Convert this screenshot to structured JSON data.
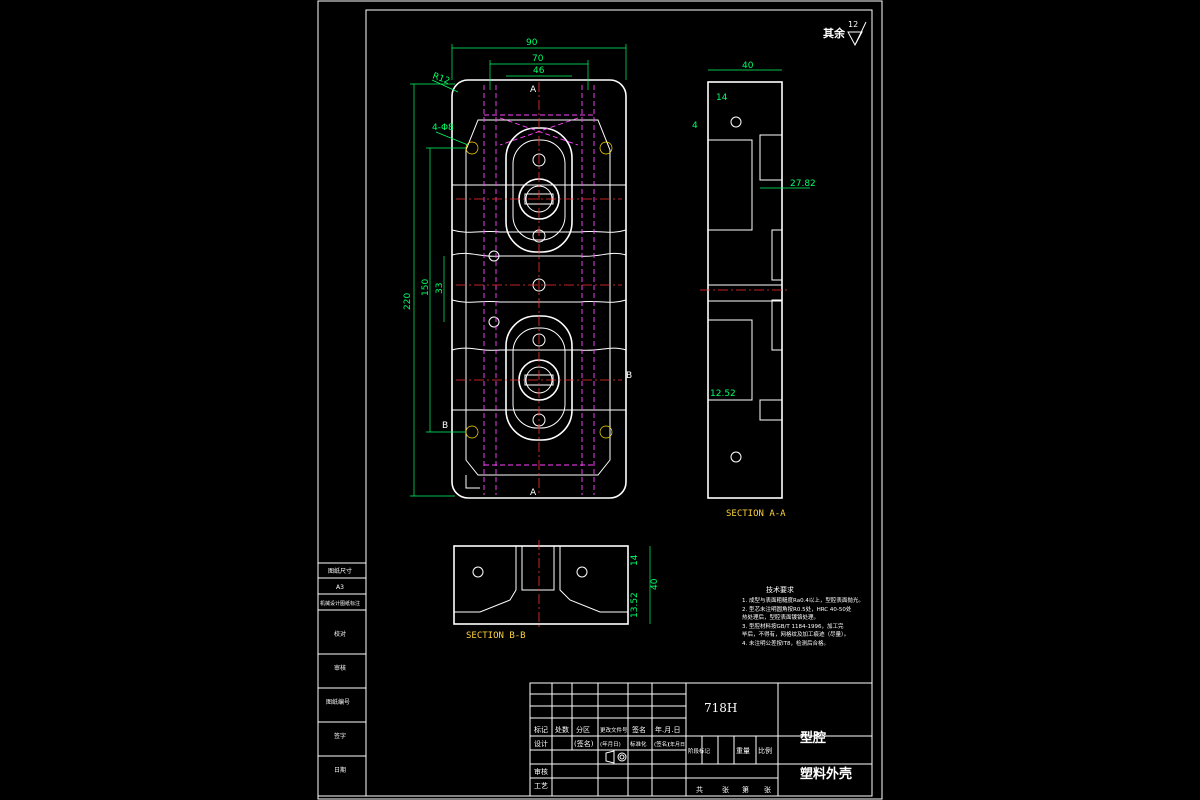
{
  "corner_mark": {
    "text": "其余",
    "roughness": "12"
  },
  "plan_dims": {
    "d90": "90",
    "d70": "70",
    "d46": "46",
    "d220": "220",
    "d150": "150",
    "d33": "33",
    "r12": "R12",
    "holes": "4-Φ8",
    "sec_a": "A",
    "sec_b": "B"
  },
  "section_aa": {
    "label": "SECTION A-A",
    "d40": "40",
    "d14": "14",
    "d4": "4",
    "d2782": "27.82",
    "d1252": "12.52"
  },
  "section_bb": {
    "label": "SECTION B-B",
    "d14": "14",
    "d40": "40",
    "d1352": "13.52"
  },
  "notes": {
    "title": "技术要求",
    "lines": [
      "1. 成型与表面粗糙度Ra0.4以上，型腔表面抛光。",
      "2. 型芯未注明圆角按R0.5处，HRC 40-50处",
      "   热处理后，型腔表面镀铬处理。",
      "3. 型腔材料按GB/T 1184-1996，加工完",
      "   毕后，不得有，网格纹及加工痕迹（尽量）。",
      "4. 未注明公差按IT8，检测后合格。"
    ]
  },
  "left_strip": [
    "图纸尺寸",
    "A3",
    "机械设计图纸标注",
    "校对",
    "审核",
    "图纸编号",
    "签字",
    "日期"
  ],
  "title_block": {
    "material": "718H",
    "part_name": "型腔",
    "product": "塑料外壳",
    "header_cells": [
      "标记",
      "处数",
      "分区",
      "更改文件号",
      "签名",
      "年.月.日"
    ],
    "row_design": [
      "设计",
      "(签名)",
      "(年月日)",
      "标准化",
      "(签名)",
      "(年月日)"
    ],
    "row_review": "审核",
    "row_process": "工艺",
    "stage_labels": [
      "阶段标记",
      "重量",
      "比例"
    ],
    "sheet_labels": [
      "共",
      "张",
      "第",
      "张"
    ]
  }
}
